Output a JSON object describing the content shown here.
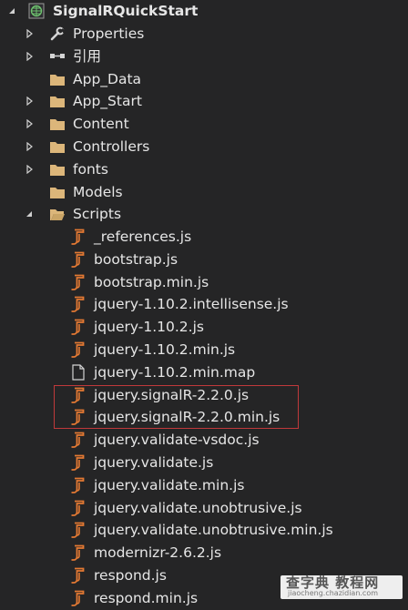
{
  "project": {
    "name": "SignalRQuickStart",
    "icon": "web-project-globe-icon"
  },
  "nodes": [
    {
      "label": "Properties",
      "icon": "wrench-icon",
      "expander": "collapsed"
    },
    {
      "label": "引用",
      "icon": "references-icon",
      "expander": "collapsed"
    },
    {
      "label": "App_Data",
      "icon": "folder-icon",
      "expander": "none"
    },
    {
      "label": "App_Start",
      "icon": "folder-icon",
      "expander": "collapsed"
    },
    {
      "label": "Content",
      "icon": "folder-icon",
      "expander": "collapsed"
    },
    {
      "label": "Controllers",
      "icon": "folder-icon",
      "expander": "collapsed"
    },
    {
      "label": "fonts",
      "icon": "folder-icon",
      "expander": "collapsed"
    },
    {
      "label": "Models",
      "icon": "folder-icon",
      "expander": "none"
    },
    {
      "label": "Scripts",
      "icon": "folder-open-icon",
      "expander": "expanded"
    }
  ],
  "scripts": [
    {
      "label": "_references.js",
      "icon": "js-file-icon"
    },
    {
      "label": "bootstrap.js",
      "icon": "js-file-icon"
    },
    {
      "label": "bootstrap.min.js",
      "icon": "js-file-icon"
    },
    {
      "label": "jquery-1.10.2.intellisense.js",
      "icon": "js-file-icon"
    },
    {
      "label": "jquery-1.10.2.js",
      "icon": "js-file-icon"
    },
    {
      "label": "jquery-1.10.2.min.js",
      "icon": "js-file-icon"
    },
    {
      "label": "jquery-1.10.2.min.map",
      "icon": "document-file-icon"
    },
    {
      "label": "jquery.signalR-2.2.0.js",
      "icon": "js-file-icon",
      "highlighted": true
    },
    {
      "label": "jquery.signalR-2.2.0.min.js",
      "icon": "js-file-icon",
      "highlighted": true
    },
    {
      "label": "jquery.validate-vsdoc.js",
      "icon": "js-file-icon"
    },
    {
      "label": "jquery.validate.js",
      "icon": "js-file-icon"
    },
    {
      "label": "jquery.validate.min.js",
      "icon": "js-file-icon"
    },
    {
      "label": "jquery.validate.unobtrusive.js",
      "icon": "js-file-icon"
    },
    {
      "label": "jquery.validate.unobtrusive.min.js",
      "icon": "js-file-icon"
    },
    {
      "label": "modernizr-2.6.2.js",
      "icon": "js-file-icon"
    },
    {
      "label": "respond.js",
      "icon": "js-file-icon"
    },
    {
      "label": "respond.min.js",
      "icon": "js-file-icon"
    }
  ],
  "colors": {
    "background": "#252526",
    "folder": "#dcb67a",
    "js_icon": "#e37933",
    "highlight_border": "#c0393b"
  },
  "watermark": {
    "line1": "查字典 教程网",
    "line2": "jiaocheng.chazidian.com"
  }
}
